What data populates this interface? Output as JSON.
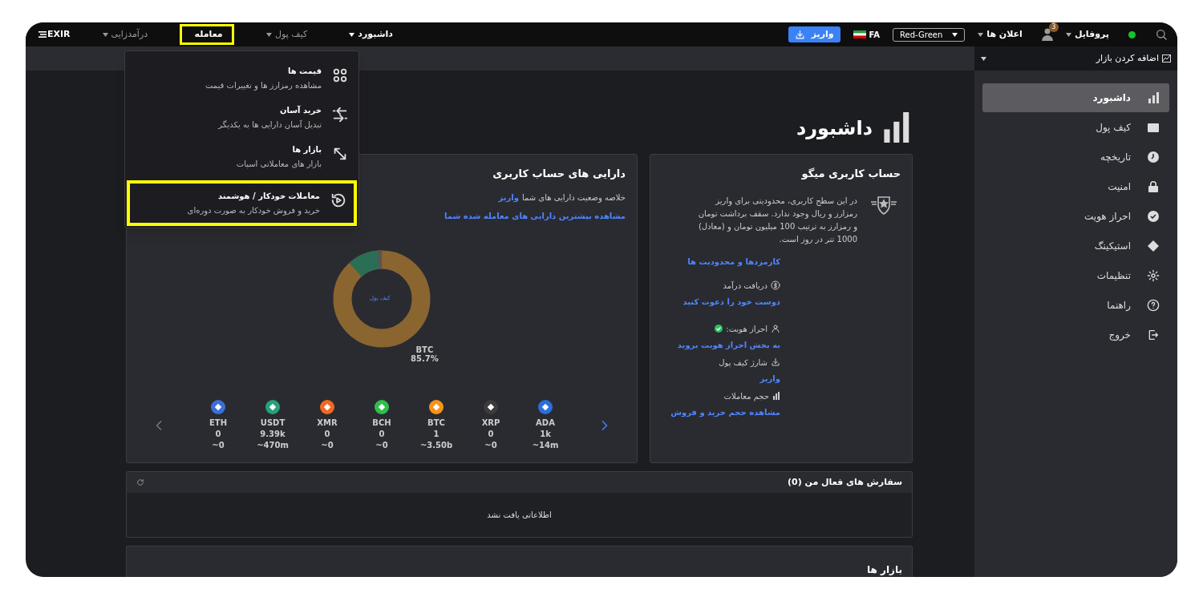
{
  "top_bar": {
    "logo": "EXIR",
    "nav": [
      {
        "label": "داشبورد",
        "selected": true,
        "expanded": false,
        "highlighted": false
      },
      {
        "label": "کیف پول",
        "selected": false,
        "expanded": false,
        "highlighted": false
      },
      {
        "label": "معامله",
        "selected": false,
        "expanded": true,
        "highlighted": true
      },
      {
        "label": "درآمدزایی",
        "selected": false,
        "expanded": false,
        "highlighted": false
      }
    ],
    "online": true,
    "profile": "پروفایل",
    "notifications": {
      "label": "اعلان ها",
      "count": "3"
    },
    "theme_select": "Red-Green",
    "language": "FA",
    "deposit_button": "واریز"
  },
  "trade_menu": [
    {
      "title": "قیمت ها",
      "description": "مشاهده رمزارز ها و تغییرات قیمت",
      "highlighted": false
    },
    {
      "title": "خرید آسان",
      "description": "تبدیل آسان دارایی ها به یکدیگر",
      "highlighted": false
    },
    {
      "title": "بازار ها",
      "description": "بازار های معاملاتی اسپات",
      "highlighted": false
    },
    {
      "title": "معاملات خودکار / هوشمند",
      "description": "خرید و فروش خودکار به صورت دوره‌ای",
      "highlighted": true
    }
  ],
  "sidebar": {
    "header": "اضافه کردن بازار",
    "items": [
      {
        "label": "داشبورد",
        "selected": true
      },
      {
        "label": "کیف پول",
        "selected": false
      },
      {
        "label": "تاریخچه",
        "selected": false
      },
      {
        "label": "امنیت",
        "selected": false
      },
      {
        "label": "احراز هویت",
        "selected": false
      },
      {
        "label": "استیکینگ",
        "selected": false
      },
      {
        "label": "تنظیمات",
        "selected": false
      },
      {
        "label": "راهنما",
        "selected": false
      },
      {
        "label": "خروج",
        "selected": false
      }
    ]
  },
  "page_title": "داشبورد",
  "account_card": {
    "title": "حساب کاربری میگو",
    "description": "در این سطح کاربری، محدودیتی برای واریز رمزارز و ریال وجود ندارد. سقف برداشت تومان و رمزارز به ترتیب 100 میلیون تومان و (معادل) 1000 تتر در روز است.",
    "fees_link": "کارمزدها و محدودیت ها",
    "rows": [
      {
        "kind": "income",
        "label": "دریافت درآمد",
        "link": "دوست خود را دعوت کنید"
      },
      {
        "kind": "identity",
        "label": "احراز هویت:",
        "verified": true,
        "link": "به بخش احراز هویت بروید"
      },
      {
        "kind": "charge",
        "label": "شارژ کیف پول",
        "link": "واریز"
      },
      {
        "kind": "volume",
        "label": "حجم معاملات",
        "link": "مشاهده حجم خرید و فروش"
      }
    ]
  },
  "assets_card": {
    "title": "دارایی های حساب کاربری",
    "summary": "خلاصه وضعیت دارایی های شما",
    "summary_link": "واریز",
    "top_link": "مشاهده بیشترین دارایی های معامله شده شما",
    "donut_center": "کیف پول",
    "donut_label": "BTC",
    "donut_percent": "85.7%",
    "coins": [
      {
        "symbol": "ADA",
        "amount": "1k",
        "value": "~14m",
        "color": "#2a6fdb"
      },
      {
        "symbol": "XRP",
        "amount": "0",
        "value": "~0",
        "color": "#3c3c3e"
      },
      {
        "symbol": "BTC",
        "amount": "1",
        "value": "~3.50b",
        "color": "#f7931a"
      },
      {
        "symbol": "BCH",
        "amount": "0",
        "value": "~0",
        "color": "#2fbf4a"
      },
      {
        "symbol": "XMR",
        "amount": "0",
        "value": "~0",
        "color": "#f26822"
      },
      {
        "symbol": "USDT",
        "amount": "9.39k",
        "value": "~470m",
        "color": "#26a17b"
      },
      {
        "symbol": "ETH",
        "amount": "0",
        "value": "~0",
        "color": "#3b6fd8"
      }
    ]
  },
  "orders_panel": {
    "title": "سفارش های فعال من (0)",
    "empty": "اطلاعاتی یافت نشد"
  },
  "markets_panel": {
    "title": "بازار ها"
  }
}
